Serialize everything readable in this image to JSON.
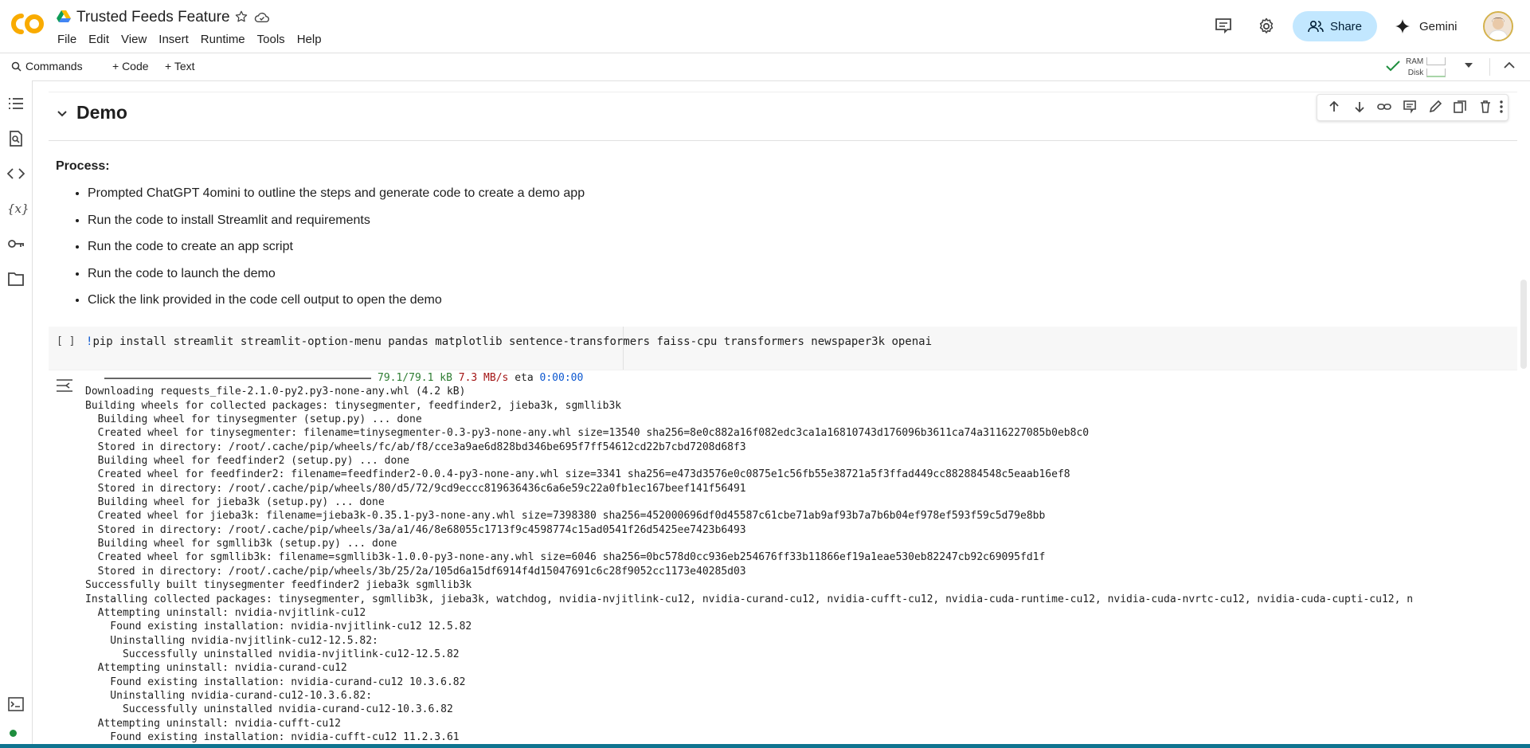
{
  "app": {
    "title": "Trusted Feeds Feature",
    "logo_text": "CO",
    "brand_color": "#f9ab00"
  },
  "menubar": [
    "File",
    "Edit",
    "View",
    "Insert",
    "Runtime",
    "Tools",
    "Help"
  ],
  "header": {
    "share_label": "Share",
    "gemini_label": "Gemini"
  },
  "toolbar": {
    "commands_label": "Commands",
    "code_label": "+ Code",
    "text_label": "+ Text",
    "ram_label": "RAM",
    "disk_label": "Disk"
  },
  "section": {
    "title": "Demo"
  },
  "text_cell": {
    "heading": "Process:",
    "steps": [
      "Prompted ChatGPT 4omini to outline the steps and generate code to create a demo app",
      "Run the code to install Streamlit and requirements",
      "Run the code to create an app script",
      "Run the code to launch the demo",
      "Click the link provided in the code cell output to open the demo"
    ]
  },
  "code_cell": {
    "run_marker": "[ ]",
    "bang": "!",
    "code": "pip install streamlit streamlit-option-menu pandas matplotlib sentence-transformers faiss-cpu transformers newspaper3k openai"
  },
  "output": {
    "progress": {
      "fraction": 1.0,
      "size": "79.1/79.1 kB",
      "rate": "7.3 MB/s",
      "eta_label": "eta",
      "eta": "0:00:00"
    },
    "lines": [
      "Downloading requests_file-2.1.0-py2.py3-none-any.whl (4.2 kB)",
      "Building wheels for collected packages: tinysegmenter, feedfinder2, jieba3k, sgmllib3k",
      "  Building wheel for tinysegmenter (setup.py) ... done",
      "  Created wheel for tinysegmenter: filename=tinysegmenter-0.3-py3-none-any.whl size=13540 sha256=8e0c882a16f082edc3ca1a16810743d176096b3611ca74a3116227085b0eb8c0",
      "  Stored in directory: /root/.cache/pip/wheels/fc/ab/f8/cce3a9ae6d828bd346be695f7ff54612cd22b7cbd7208d68f3",
      "  Building wheel for feedfinder2 (setup.py) ... done",
      "  Created wheel for feedfinder2: filename=feedfinder2-0.0.4-py3-none-any.whl size=3341 sha256=e473d3576e0c0875e1c56fb55e38721a5f3ffad449cc882884548c5eaab16ef8",
      "  Stored in directory: /root/.cache/pip/wheels/80/d5/72/9cd9eccc819636436c6a6e59c22a0fb1ec167beef141f56491",
      "  Building wheel for jieba3k (setup.py) ... done",
      "  Created wheel for jieba3k: filename=jieba3k-0.35.1-py3-none-any.whl size=7398380 sha256=452000696df0d45587c61cbe71ab9af93b7a7b6b04ef978ef593f59c5d79e8bb",
      "  Stored in directory: /root/.cache/pip/wheels/3a/a1/46/8e68055c1713f9c4598774c15ad0541f26d5425ee7423b6493",
      "  Building wheel for sgmllib3k (setup.py) ... done",
      "  Created wheel for sgmllib3k: filename=sgmllib3k-1.0.0-py3-none-any.whl size=6046 sha256=0bc578d0cc936eb254676ff33b11866ef19a1eae530eb82247cb92c69095fd1f",
      "  Stored in directory: /root/.cache/pip/wheels/3b/25/2a/105d6a15df6914f4d15047691c6c28f9052cc1173e40285d03",
      "Successfully built tinysegmenter feedfinder2 jieba3k sgmllib3k",
      "Installing collected packages: tinysegmenter, sgmllib3k, jieba3k, watchdog, nvidia-nvjitlink-cu12, nvidia-curand-cu12, nvidia-cufft-cu12, nvidia-cuda-runtime-cu12, nvidia-cuda-nvrtc-cu12, nvidia-cuda-cupti-cu12, n",
      "  Attempting uninstall: nvidia-nvjitlink-cu12",
      "    Found existing installation: nvidia-nvjitlink-cu12 12.5.82",
      "    Uninstalling nvidia-nvjitlink-cu12-12.5.82:",
      "      Successfully uninstalled nvidia-nvjitlink-cu12-12.5.82",
      "  Attempting uninstall: nvidia-curand-cu12",
      "    Found existing installation: nvidia-curand-cu12 10.3.6.82",
      "    Uninstalling nvidia-curand-cu12-10.3.6.82:",
      "      Successfully uninstalled nvidia-curand-cu12-10.3.6.82",
      "  Attempting uninstall: nvidia-cufft-cu12",
      "    Found existing installation: nvidia-cufft-cu12 11.2.3.61"
    ]
  },
  "icons": {
    "rail": [
      "table-of-contents-icon",
      "find-replace-icon",
      "code-snippets-icon",
      "variables-icon",
      "secrets-key-icon",
      "files-folder-icon"
    ],
    "cell_toolbar": [
      "move-up-icon",
      "move-down-icon",
      "link-icon",
      "comment-icon",
      "edit-icon",
      "mirror-cell-icon",
      "delete-icon",
      "more-vert-icon"
    ]
  },
  "colors": {
    "share_bg": "#c2e7ff",
    "connected": "#1e8e3e",
    "code_keyword": "#0b57d0"
  }
}
